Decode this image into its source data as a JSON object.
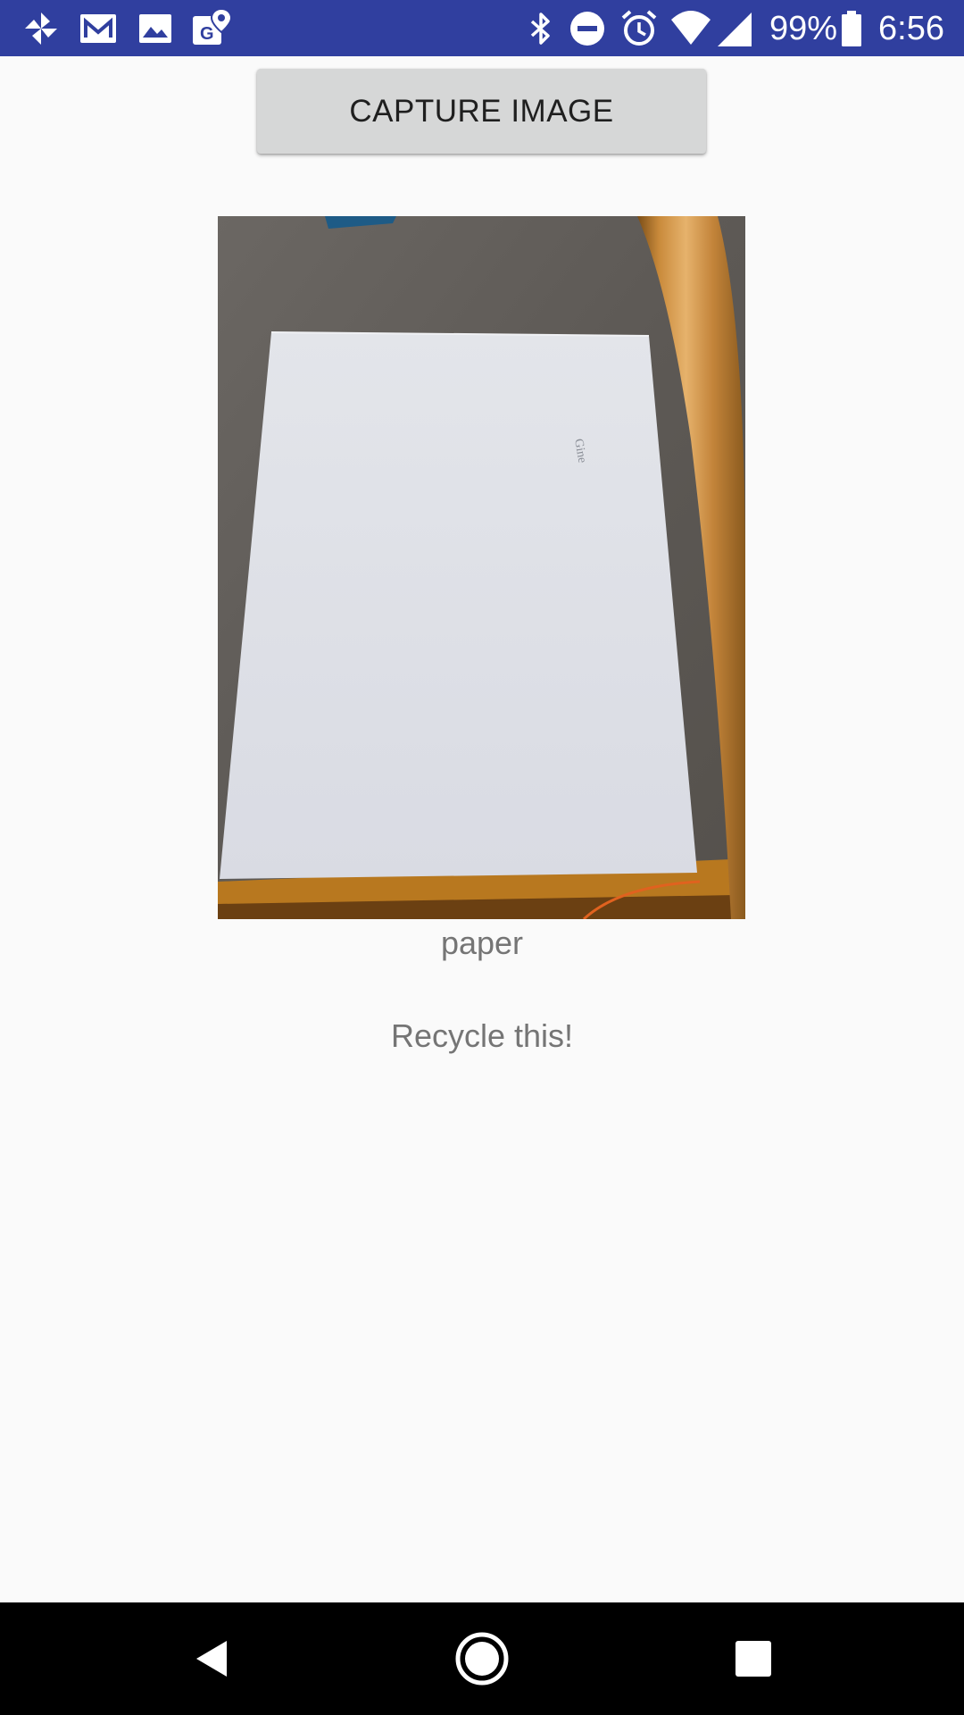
{
  "status_bar": {
    "background_color": "#303f9f",
    "left_icons": [
      "pinwheel-icon",
      "gmail-icon",
      "photos-icon",
      "maps-icon"
    ],
    "right_icons": [
      "bluetooth-icon",
      "do-not-disturb-icon",
      "alarm-icon",
      "wifi-icon",
      "cell-signal-icon",
      "battery-icon"
    ],
    "battery_percent": "99%",
    "time": "6:56"
  },
  "main": {
    "capture_button_label": "CAPTURE IMAGE",
    "photo": {
      "alt": "Captured photo of a sheet of white paper on a desk",
      "handwriting": "Gine"
    },
    "classification_label": "paper",
    "recommendation": "Recycle this!"
  },
  "nav_bar": {
    "buttons": [
      "back-icon",
      "home-icon",
      "recents-icon"
    ]
  }
}
